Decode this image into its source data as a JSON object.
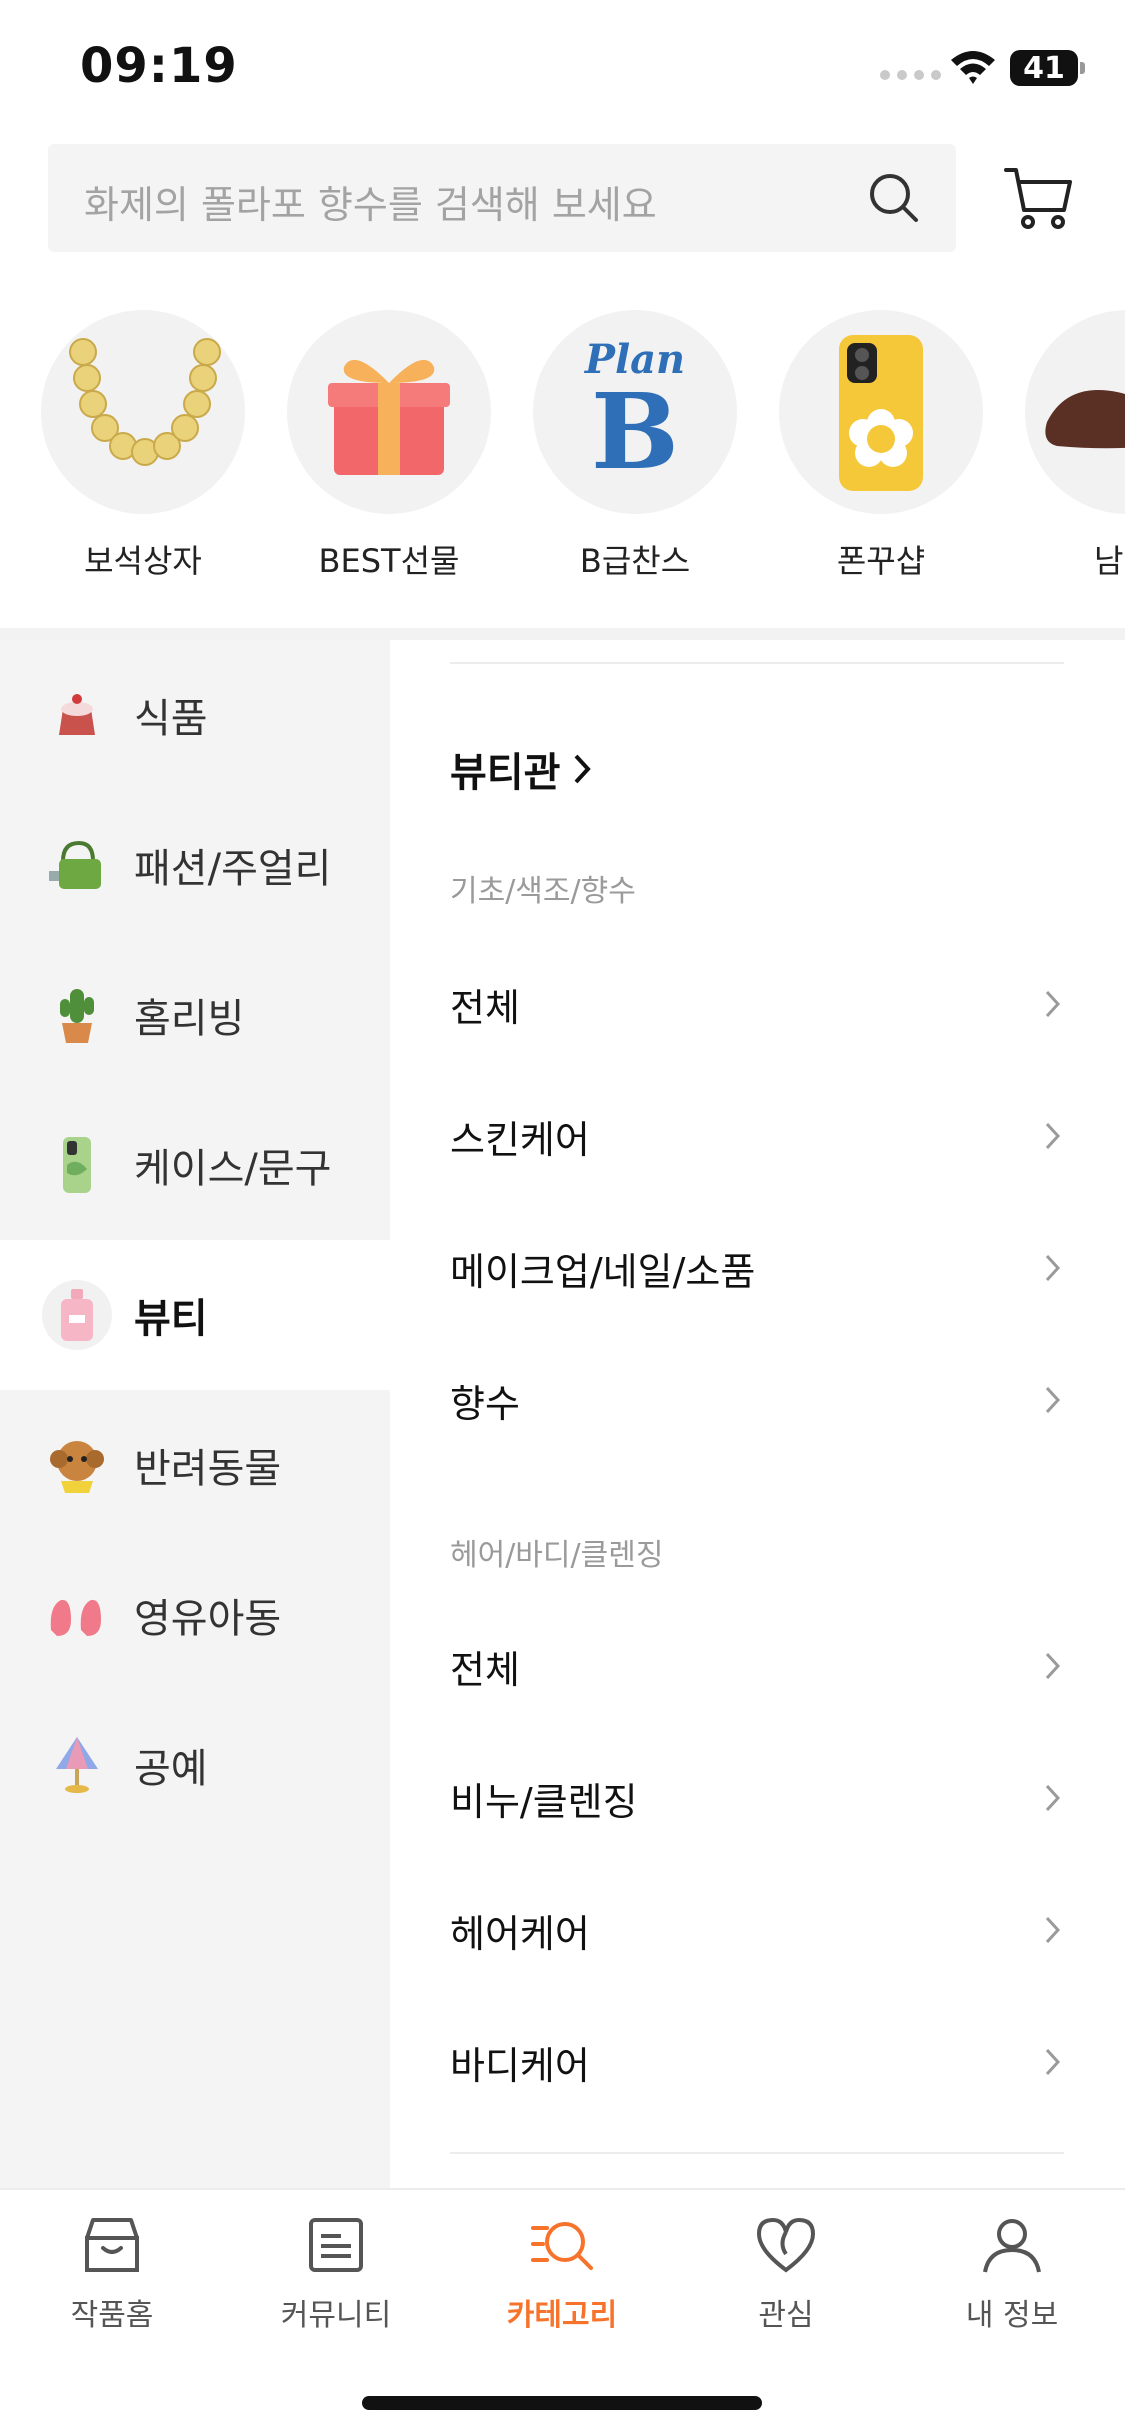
{
  "status_bar": {
    "time": "09:19",
    "battery": "41"
  },
  "search": {
    "placeholder": "화제의 폴라포 향수를 검색해 보세요"
  },
  "stories": [
    {
      "label": "보석상자"
    },
    {
      "label": "BEST선물"
    },
    {
      "label": "B급찬스",
      "logo_top": "Plan",
      "logo_main": "B"
    },
    {
      "label": "폰꾸샵"
    },
    {
      "label": "남"
    }
  ],
  "categories": [
    {
      "label": "식품"
    },
    {
      "label": "패션/주얼리"
    },
    {
      "label": "홈리빙"
    },
    {
      "label": "케이스/문구"
    },
    {
      "label": "뷰티",
      "active": true
    },
    {
      "label": "반려동물"
    },
    {
      "label": "영유아동"
    },
    {
      "label": "공예"
    }
  ],
  "submenu": {
    "brand_link": "뷰티관",
    "groups": [
      {
        "title": "기초/색조/향수",
        "items": [
          "전체",
          "스킨케어",
          "메이크업/네일/소품",
          "향수"
        ]
      },
      {
        "title": "헤어/바디/클렌징",
        "items": [
          "전체",
          "비누/클렌징",
          "헤어케어",
          "바디케어"
        ]
      }
    ]
  },
  "tab_bar": {
    "tabs": [
      {
        "label": "작품홈",
        "icon": "store-icon"
      },
      {
        "label": "커뮤니티",
        "icon": "community-icon"
      },
      {
        "label": "카테고리",
        "icon": "category-search-icon",
        "active": true
      },
      {
        "label": "관심",
        "icon": "heart-icon"
      },
      {
        "label": "내 정보",
        "icon": "profile-icon"
      }
    ]
  },
  "colors": {
    "accent": "#f7732b",
    "panel_bg": "#f4f4f4"
  }
}
